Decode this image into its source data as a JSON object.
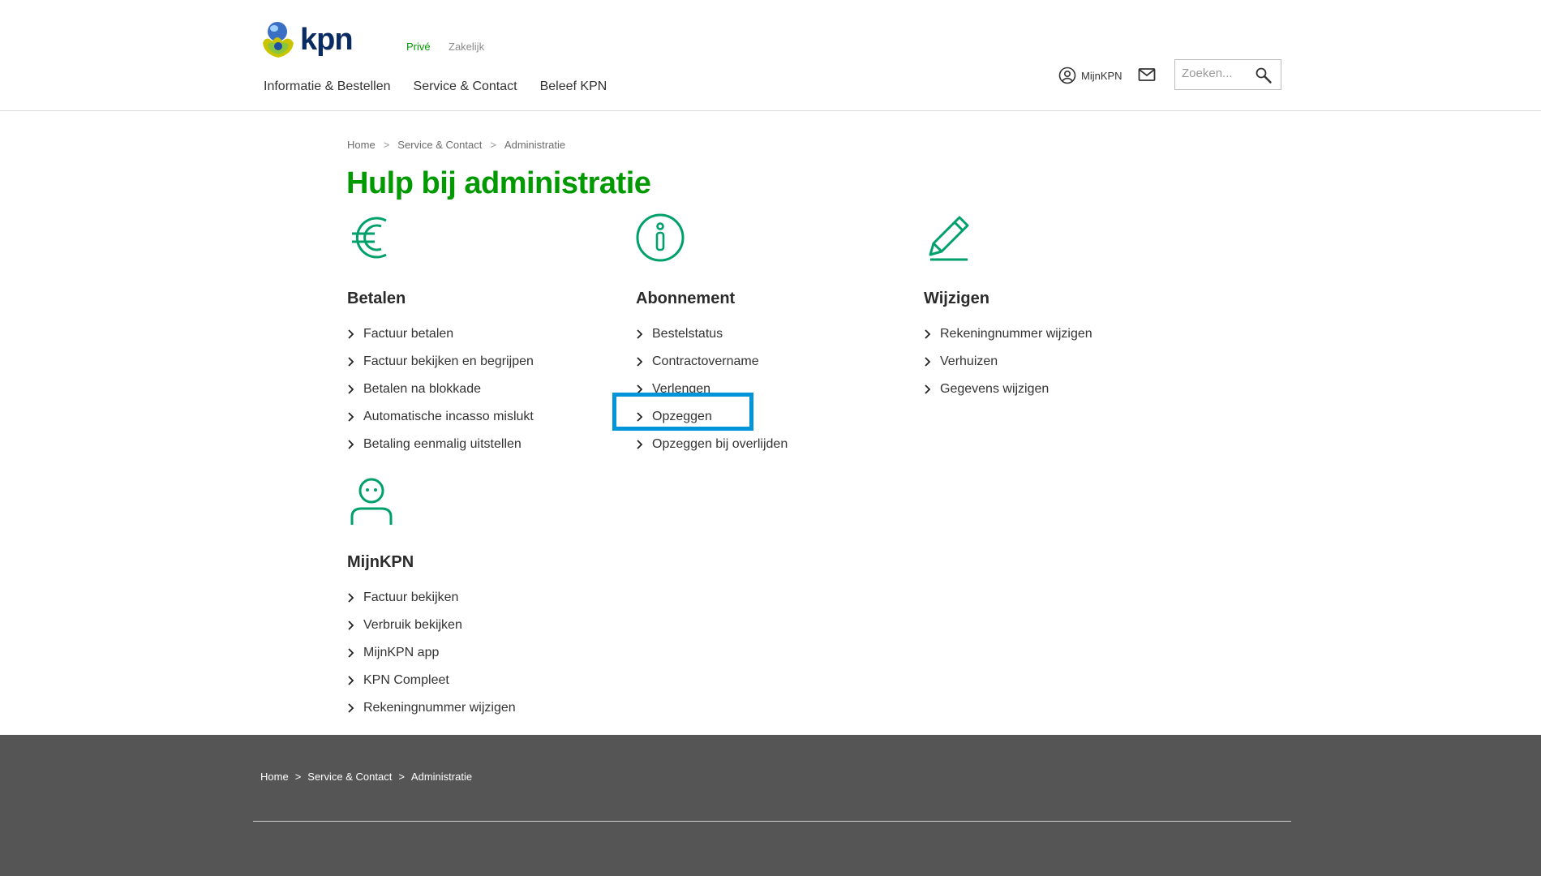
{
  "header": {
    "logo_text": "kpn",
    "segments": {
      "prive": "Privé",
      "zakelijk": "Zakelijk"
    },
    "nav": [
      "Informatie & Bestellen",
      "Service & Contact",
      "Beleef KPN"
    ],
    "mijnkpn_label": "MijnKPN",
    "search_placeholder": "Zoeken...",
    "icons": {
      "account": "user-circle-icon",
      "mail": "envelope-icon",
      "search": "magnifier-icon"
    }
  },
  "breadcrumb": [
    "Home",
    "Service & Contact",
    "Administratie"
  ],
  "page_title": "Hulp bij administratie",
  "columns": {
    "betalen": {
      "icon": "euro-icon",
      "title": "Betalen",
      "links": [
        "Factuur betalen",
        "Factuur bekijken en begrijpen",
        "Betalen na blokkade",
        "Automatische incasso mislukt",
        "Betaling eenmalig uitstellen"
      ]
    },
    "abonnement": {
      "icon": "info-icon",
      "title": "Abonnement",
      "links": [
        "Bestelstatus",
        "Contractovername",
        "Verlengen",
        "Opzeggen",
        "Opzeggen bij overlijden"
      ]
    },
    "wijzigen": {
      "icon": "pencil-icon",
      "title": "Wijzigen",
      "links": [
        "Rekeningnummer wijzigen",
        "Verhuizen",
        "Gegevens wijzigen"
      ]
    },
    "mijnkpn": {
      "icon": "person-icon",
      "title": "MijnKPN",
      "links": [
        "Factuur bekijken",
        "Verbruik bekijken",
        "MijnKPN app",
        "KPN Compleet",
        "Rekeningnummer wijzigen"
      ]
    }
  },
  "footer": {
    "breadcrumb": [
      "Home",
      "Service & Contact",
      "Administratie"
    ]
  },
  "colors": {
    "brand_green": "#009900",
    "icon_green": "#00a06a",
    "highlight_blue": "#0094d9",
    "footer_bg": "#555555"
  }
}
